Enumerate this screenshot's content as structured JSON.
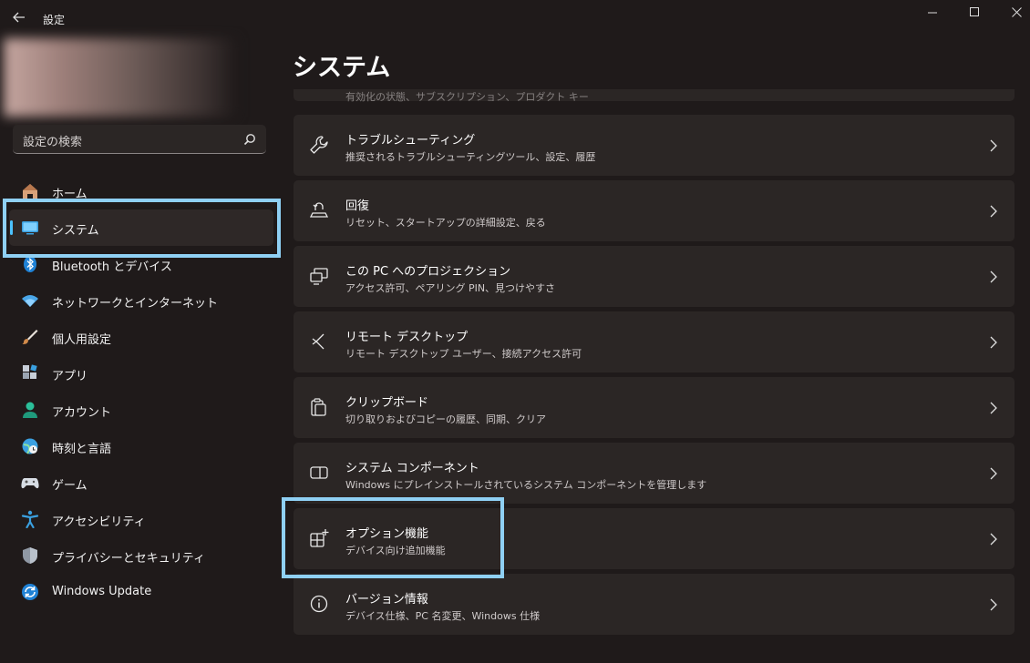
{
  "app": {
    "title": "設定"
  },
  "search": {
    "placeholder": "設定の検索"
  },
  "sidebar": {
    "items": [
      {
        "label": "ホーム",
        "icon": "home-icon"
      },
      {
        "label": "システム",
        "icon": "system-icon",
        "selected": true
      },
      {
        "label": "Bluetooth とデバイス",
        "icon": "bluetooth-icon"
      },
      {
        "label": "ネットワークとインターネット",
        "icon": "network-icon"
      },
      {
        "label": "個人用設定",
        "icon": "personalization-icon"
      },
      {
        "label": "アプリ",
        "icon": "apps-icon"
      },
      {
        "label": "アカウント",
        "icon": "account-icon"
      },
      {
        "label": "時刻と言語",
        "icon": "time-language-icon"
      },
      {
        "label": "ゲーム",
        "icon": "gaming-icon"
      },
      {
        "label": "アクセシビリティ",
        "icon": "accessibility-icon"
      },
      {
        "label": "プライバシーとセキュリティ",
        "icon": "privacy-shield-icon"
      },
      {
        "label": "Windows Update",
        "icon": "windows-update-icon"
      }
    ]
  },
  "main": {
    "title": "システム",
    "partial_item_desc": "有効化の状態、サブスクリプション、プロダクト キー",
    "items": [
      {
        "title": "トラブルシューティング",
        "desc": "推奨されるトラブルシューティングツール、設定、履歴",
        "icon": "wrench-icon"
      },
      {
        "title": "回復",
        "desc": "リセット、スタートアップの詳細設定、戻る",
        "icon": "recovery-icon"
      },
      {
        "title": "この PC へのプロジェクション",
        "desc": "アクセス許可、ペアリング PIN、見つけやすさ",
        "icon": "projection-icon"
      },
      {
        "title": "リモート デスクトップ",
        "desc": "リモート デスクトップ ユーザー、接続アクセス許可",
        "icon": "remote-desktop-icon"
      },
      {
        "title": "クリップボード",
        "desc": "切り取りおよびコピーの履歴、同期、クリア",
        "icon": "clipboard-icon"
      },
      {
        "title": "システム コンポーネント",
        "desc": "Windows にプレインストールされているシステム コンポーネントを管理します",
        "icon": "system-components-icon"
      },
      {
        "title": "オプション機能",
        "desc": "デバイス向け追加機能",
        "icon": "optional-features-icon"
      },
      {
        "title": "バージョン情報",
        "desc": "デバイス仕様、PC 名変更、Windows 仕様",
        "icon": "info-icon"
      }
    ]
  },
  "colors": {
    "accent": "#4cc2ff",
    "highlight": "#8fd0f4",
    "background": "#1f1a1a",
    "card": "#2b2625"
  }
}
